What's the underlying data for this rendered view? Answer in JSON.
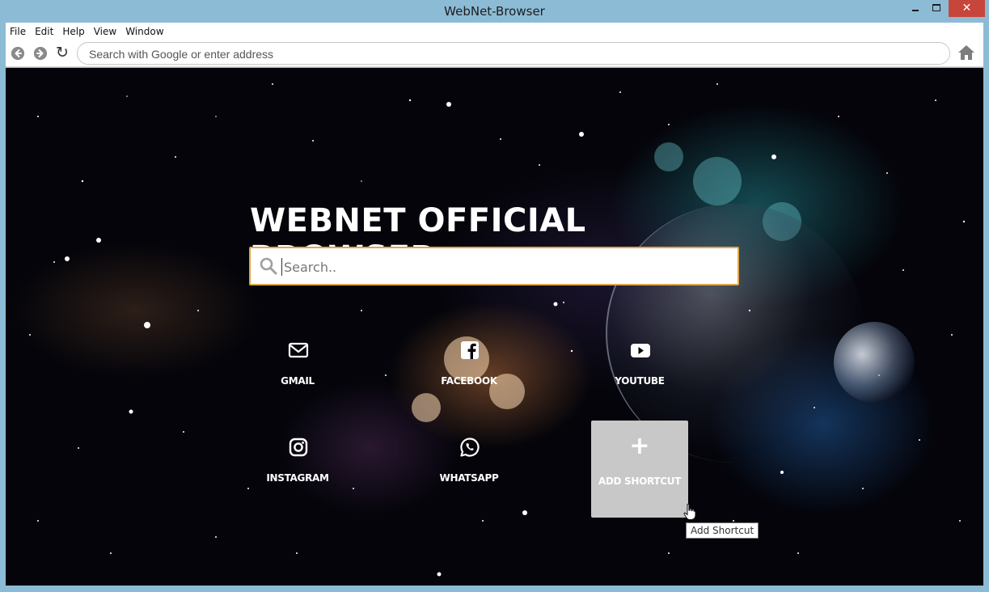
{
  "window": {
    "title": "WebNet-Browser",
    "close_glyph": "✕"
  },
  "menu": [
    "File",
    "Edit",
    "Help",
    "View",
    "Window"
  ],
  "nav": {
    "back_icon": "back-arrow-icon",
    "forward_icon": "forward-arrow-icon",
    "reload_glyph": "↻",
    "address_placeholder": "Search with Google or enter address",
    "home_icon": "home-icon"
  },
  "page": {
    "title": "WEBNET OFFICIAL BROWSER",
    "search_placeholder": "Search..",
    "accent_color": "#e0a54a",
    "shortcuts": [
      {
        "label": "GMAIL",
        "icon": "mail-icon"
      },
      {
        "label": "FACEBOOK",
        "icon": "facebook-icon"
      },
      {
        "label": "YOUTUBE",
        "icon": "youtube-icon"
      },
      {
        "label": "INSTAGRAM",
        "icon": "instagram-icon"
      },
      {
        "label": "WHATSAPP",
        "icon": "whatsapp-icon"
      }
    ],
    "add_shortcut": {
      "label": "ADD SHORTCUT",
      "glyph": "+"
    },
    "tooltip": "Add Shortcut"
  }
}
